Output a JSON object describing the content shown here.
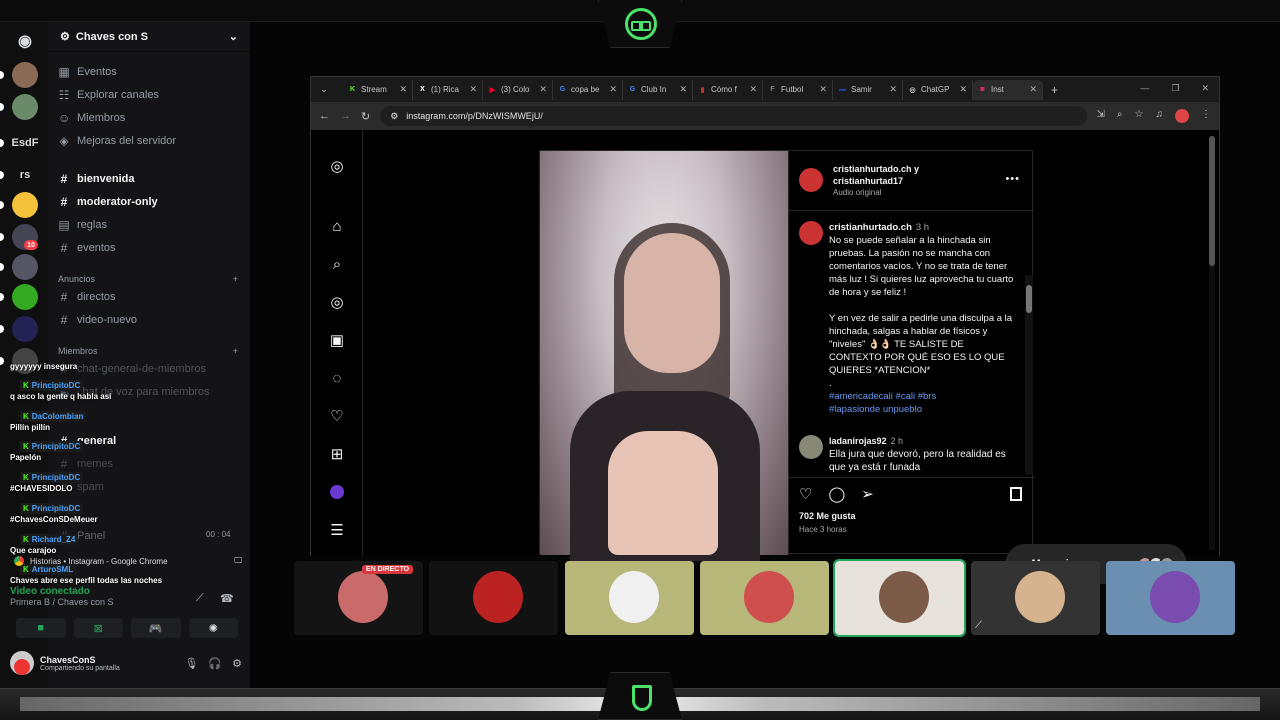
{
  "discord": {
    "servers": [
      {
        "label": "",
        "icon": "discord-icon"
      },
      {
        "label": ""
      },
      {
        "label": ""
      },
      {
        "label": "EsdF"
      },
      {
        "label": "rs"
      },
      {
        "label": ""
      },
      {
        "label": "",
        "badge": "10"
      },
      {
        "label": ""
      },
      {
        "label": ""
      },
      {
        "label": ""
      },
      {
        "label": ""
      }
    ],
    "guild_name": "Chaves con S",
    "menu_items": [
      "Eventos",
      "Explorar canales",
      "Miembros",
      "Mejoras del servidor"
    ],
    "channels_top": [
      "bienvenida",
      "moderator-only",
      "reglas",
      "eventos"
    ],
    "category_anuncios": "Anuncios",
    "channels_anuncios": [
      "directos",
      "video-nuevo"
    ],
    "category_miembros": "Miembros",
    "channels_miembros_partial": [
      "chat-general-de-miembros",
      "chat de voz para miembros",
      "general",
      "memes",
      "spam",
      "Panel"
    ],
    "counter": "00 : 04",
    "voice_status": "Video conectado",
    "voice_location": "Primera B / Chaves con S",
    "user_name": "ChavesConS",
    "user_status": "Compartiendo su pantalla"
  },
  "chat_overlay": [
    {
      "user": "",
      "text": "gyyyyyy insegura"
    },
    {
      "user": "PrincipitoDC",
      "text": "q asco la gente q habla asi"
    },
    {
      "user": "DaColombian",
      "text": "Pillín pillín"
    },
    {
      "user": "PrincipitoDC",
      "text": "Papelón"
    },
    {
      "user": "PrincipitoDC",
      "text": "#CHAVESIDOLO"
    },
    {
      "user": "PrincipitoDC",
      "text": "#ChavesConSDeMeuer"
    },
    {
      "user": "Richard_Z4",
      "text": "Que carajoo"
    },
    {
      "user": "ArturoSML",
      "text": "Chaves abre ese perfil todas las noches"
    }
  ],
  "stream_window_label": "Historias • Instagram - Google Chrome",
  "browser": {
    "tabs": [
      {
        "label": "Stream",
        "color": "#53fc18",
        "glyph": "K"
      },
      {
        "label": "(1) Rica",
        "color": "#ffffff",
        "glyph": "X"
      },
      {
        "label": "(3) Colo",
        "color": "#ff0033",
        "glyph": "▶"
      },
      {
        "label": "copa be",
        "color": "#4285f4",
        "glyph": "G"
      },
      {
        "label": "Club In",
        "color": "#4285f4",
        "glyph": "G"
      },
      {
        "label": "Cómo f",
        "color": "#c4302b",
        "glyph": "▮"
      },
      {
        "label": "Futbol",
        "color": "#888888",
        "glyph": "F"
      },
      {
        "label": "Samir",
        "color": "#2040a0",
        "glyph": "▬"
      },
      {
        "label": "ChatGP",
        "color": "#cccccc",
        "glyph": "◎"
      },
      {
        "label": "Inst",
        "color": "#e1306c",
        "glyph": "◙"
      }
    ],
    "url": "instagram.com/p/DNzWISMWEjU/"
  },
  "post": {
    "author_line1": "cristianhurtado.ch y",
    "author_line2": "cristianhurtad17",
    "audio": "Audio original",
    "caption_user": "cristianhurtado.ch",
    "caption_time": "3 h",
    "caption_p1": "No se puede señalar a la hinchada sin pruebas. La pasión no se mancha con comentarios vacíos. Y no se trata de tener más luz ! Si quieres luz aprovecha tu cuarto de hora y se feliz !",
    "caption_p2": "Y en vez de salir a pedirle una disculpa a la hinchada, salgas a hablar de físicos y \"niveles\" 👌🏻👌🏻 TE SALISTE DE CONTEXTO POR QUÉ ESO ES LO QUE QUIERES *ATENCION*",
    "caption_dot": ".",
    "tags_line1": "#americadecali #cali #brs",
    "tags_line2": "#lapasionde unpueblo",
    "comment_user": "ladanirojas92",
    "comment_time": "2 h",
    "comment_text": "Ella jura que devoró, pero la realidad es que ya está r funada",
    "likes": "702 Me gusta",
    "ago": "Hace 3 horas",
    "messages_label": "Mensajes"
  },
  "tiles": [
    {
      "name": "tile-1",
      "live": "EN DIRECTO",
      "bg": "#141414",
      "accent": "#c96b6b"
    },
    {
      "name": "tile-2",
      "bg": "#121212",
      "accent": "#b22"
    },
    {
      "name": "tile-3",
      "bg": "#b7b77a",
      "accent": "#f0f0f0"
    },
    {
      "name": "tile-4",
      "bg": "#b7b77a",
      "accent": "#cf4f4f"
    },
    {
      "name": "tile-5",
      "bg": "#e8e2dc",
      "accent": "#7b5a48"
    },
    {
      "name": "tile-6",
      "bg": "#333333",
      "accent": "#d6b38f"
    },
    {
      "name": "tile-7",
      "bg": "#6a8fb0",
      "accent": "#7b4caf"
    }
  ]
}
